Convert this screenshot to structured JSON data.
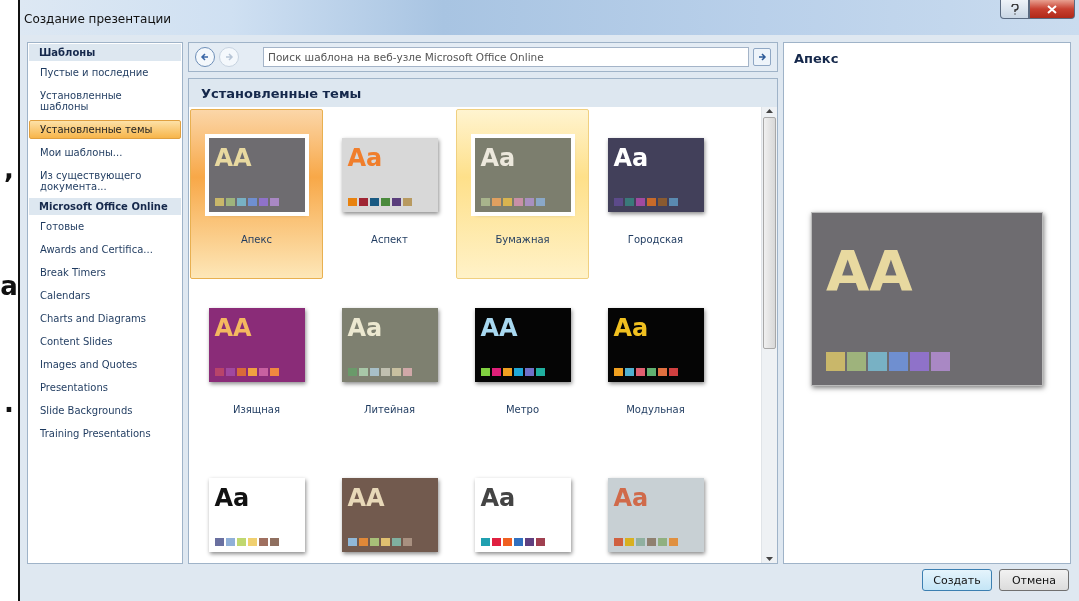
{
  "background_text": [
    ",",
    "a",
    "."
  ],
  "window": {
    "title": "Создание презентации"
  },
  "sidebar": {
    "sections": [
      {
        "heading": "Шаблоны",
        "items": [
          {
            "label": "Пустые и последние",
            "selected": false
          },
          {
            "label": "Установленные шаблоны",
            "selected": false
          },
          {
            "label": "Установленные темы",
            "selected": true
          },
          {
            "label": "Мои шаблоны...",
            "selected": false
          },
          {
            "label": "Из существующего документа...",
            "selected": false
          }
        ]
      },
      {
        "heading": "Microsoft Office Online",
        "items": [
          {
            "label": "Готовые",
            "selected": false
          },
          {
            "label": "Awards and Certifica...",
            "selected": false
          },
          {
            "label": "Break Timers",
            "selected": false
          },
          {
            "label": "Calendars",
            "selected": false
          },
          {
            "label": "Charts and Diagrams",
            "selected": false
          },
          {
            "label": "Content Slides",
            "selected": false
          },
          {
            "label": "Images and Quotes",
            "selected": false
          },
          {
            "label": "Presentations",
            "selected": false
          },
          {
            "label": "Slide Backgrounds",
            "selected": false
          },
          {
            "label": "Training Presentations",
            "selected": false
          }
        ]
      }
    ]
  },
  "search": {
    "placeholder": "Поиск шаблона на веб-узле Microsoft Office Online"
  },
  "gallery": {
    "title": "Установленные темы",
    "themes": [
      {
        "name": "Апекс",
        "color": "#6e6c70",
        "selected": true,
        "hovered": false,
        "sample": {
          "text": "AA",
          "color": "#e8d9a0"
        },
        "swatches": [
          {
            "color": "#c9b76a"
          },
          {
            "color": "#9eb37c"
          },
          {
            "color": "#78b1c4"
          },
          {
            "color": "#6f8fd0"
          },
          {
            "color": "#8f72c9"
          },
          {
            "color": "#a988c4"
          }
        ]
      },
      {
        "name": "Аспект",
        "color": "#d8d8d8",
        "selected": false,
        "hovered": false,
        "sample": {
          "text": "Aa",
          "color": "#f07e2c"
        },
        "swatches": [
          {
            "color": "#e8820e"
          },
          {
            "color": "#a02634"
          },
          {
            "color": "#1a5a82"
          },
          {
            "color": "#4a8a3c"
          },
          {
            "color": "#5a3e7c"
          },
          {
            "color": "#b89a60"
          }
        ]
      },
      {
        "name": "Бумажная",
        "color": "#7c7e6e",
        "selected": false,
        "hovered": true,
        "sample": {
          "text": "Aa",
          "color": "#ece8dc"
        },
        "swatches": [
          {
            "color": "#a8b48c"
          },
          {
            "color": "#e0a060"
          },
          {
            "color": "#d8b450"
          },
          {
            "color": "#c890a8"
          },
          {
            "color": "#a890c0"
          },
          {
            "color": "#8aa8c8"
          }
        ]
      },
      {
        "name": "Городская",
        "color": "#42405a",
        "selected": false,
        "hovered": false,
        "sample": {
          "text": "Aa",
          "color": "#ffffff"
        },
        "swatches": [
          {
            "color": "#5c4a8a"
          },
          {
            "color": "#3a7a7a"
          },
          {
            "color": "#a04aa0"
          },
          {
            "color": "#c86a2a"
          },
          {
            "color": "#8a5a30"
          },
          {
            "color": "#5a8ab0"
          }
        ]
      },
      {
        "name": "Изящная",
        "color": "#8a2c78",
        "selected": false,
        "hovered": false,
        "sample": {
          "text": "AA",
          "color": "#f4b860"
        },
        "swatches": [
          {
            "color": "#b8446a"
          },
          {
            "color": "#a048a0"
          },
          {
            "color": "#d86a3a"
          },
          {
            "color": "#f0a040"
          },
          {
            "color": "#c860a0"
          },
          {
            "color": "#f08840"
          }
        ]
      },
      {
        "name": "Литейная",
        "color": "#7e8070",
        "selected": false,
        "hovered": false,
        "sample": {
          "text": "Aa",
          "color": "#ece8d0"
        },
        "swatches": [
          {
            "color": "#6a9a6a"
          },
          {
            "color": "#a8c8a8"
          },
          {
            "color": "#a8c0c8"
          },
          {
            "color": "#c0c0b0"
          },
          {
            "color": "#c8c0a0"
          },
          {
            "color": "#d0a8a8"
          }
        ]
      },
      {
        "name": "Метро",
        "color": "#050505",
        "selected": false,
        "hovered": false,
        "sample": {
          "text": "AA",
          "color": "#a8d8f0"
        },
        "swatches": [
          {
            "color": "#80d040"
          },
          {
            "color": "#e0207a"
          },
          {
            "color": "#f0a020"
          },
          {
            "color": "#20a8d8"
          },
          {
            "color": "#7070c8"
          },
          {
            "color": "#20b0a0"
          }
        ]
      },
      {
        "name": "Модульная",
        "color": "#050505",
        "selected": false,
        "hovered": false,
        "sample": {
          "text": "Aa",
          "color": "#f0c020"
        },
        "swatches": [
          {
            "color": "#f0a020"
          },
          {
            "color": "#50b0d0"
          },
          {
            "color": "#e06070"
          },
          {
            "color": "#60b070"
          },
          {
            "color": "#e07040"
          },
          {
            "color": "#d04040"
          }
        ]
      },
      {
        "color": "#ffffff",
        "selected": false,
        "hovered": false,
        "sample": {
          "text": "Aa",
          "color": "#111111"
        },
        "swatches": [
          {
            "color": "#6a70a0"
          },
          {
            "color": "#90b0d8"
          },
          {
            "color": "#c0d870"
          },
          {
            "color": "#f0d070"
          },
          {
            "color": "#a07060"
          },
          {
            "color": "#907060"
          }
        ]
      },
      {
        "color": "#725a4e",
        "selected": false,
        "hovered": false,
        "sample": {
          "text": "AA",
          "color": "#e8d8b8"
        },
        "swatches": [
          {
            "color": "#90b8d8"
          },
          {
            "color": "#e08838"
          },
          {
            "color": "#a8c078"
          },
          {
            "color": "#e0c070"
          },
          {
            "color": "#80b0a0"
          },
          {
            "color": "#a89080"
          }
        ]
      },
      {
        "color": "#ffffff",
        "selected": false,
        "hovered": false,
        "sample": {
          "text": "Aa",
          "color": "#444444"
        },
        "swatches": [
          {
            "color": "#20a0b0"
          },
          {
            "color": "#e02040"
          },
          {
            "color": "#f06020"
          },
          {
            "color": "#3070c0"
          },
          {
            "color": "#604080"
          },
          {
            "color": "#a04050"
          }
        ]
      },
      {
        "color": "#c8d0d4",
        "selected": false,
        "hovered": false,
        "sample": {
          "text": "Aa",
          "color": "#d06a4a"
        },
        "swatches": [
          {
            "color": "#d06040"
          },
          {
            "color": "#d8b020"
          },
          {
            "color": "#90b0a0"
          },
          {
            "color": "#908070"
          },
          {
            "color": "#90b080"
          },
          {
            "color": "#e09040"
          }
        ]
      }
    ]
  },
  "preview": {
    "title": "Апекс",
    "color": "#6e6c70",
    "sample": {
      "text": "AA",
      "color": "#e8d9a0"
    },
    "swatches": [
      {
        "color": "#c9b76a"
      },
      {
        "color": "#9eb37c"
      },
      {
        "color": "#78b1c4"
      },
      {
        "color": "#6f8fd0"
      },
      {
        "color": "#8f72c9"
      },
      {
        "color": "#a988c4"
      }
    ]
  },
  "buttons": [
    {
      "label": "Создать",
      "default": true
    },
    {
      "label": "Отмена",
      "default": false
    }
  ]
}
